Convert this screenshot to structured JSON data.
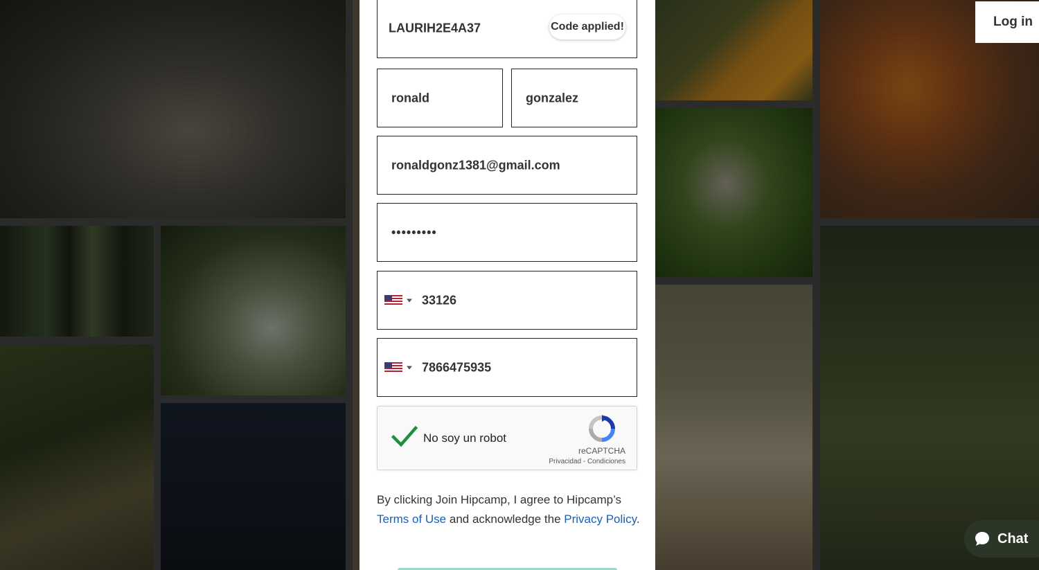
{
  "form": {
    "promo_code": "LAURIH2E4A37",
    "promo_status": "Code applied!",
    "first_name": "ronald",
    "last_name": "gonzalez",
    "email": "ronaldgonz1381@gmail.com",
    "password_masked": "•••••••••",
    "zip_code": "33126",
    "phone": "7866475935"
  },
  "captcha": {
    "label": "No soy un robot",
    "brand": "reCAPTCHA",
    "links": "Privacidad - Condiciones"
  },
  "terms": {
    "prefix": "By clicking Join Hipcamp, I agree to Hipcamp’s ",
    "terms_link": "Terms of Use",
    "middle": " and acknowledge the ",
    "privacy_link": "Privacy Policy",
    "suffix": "."
  },
  "header": {
    "login_label": "Log in"
  },
  "chat": {
    "label": "Chat"
  },
  "colors": {
    "link": "#1a5fb4",
    "check": "#1e8e3e",
    "chat_bg": "#2c3626"
  },
  "icons": {
    "flag": "us-flag-icon",
    "captcha_check": "checkmark-icon",
    "captcha_logo": "recaptcha-icon",
    "chat": "chat-bubble-icon"
  }
}
